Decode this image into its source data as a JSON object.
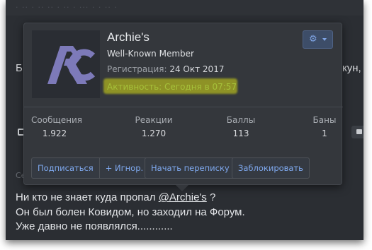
{
  "background": {
    "top_strip_text": "· ·· · ·· ·· · ·· · ··· · · ·· ·",
    "line_left_char": "Б",
    "line_right_text": "кун,",
    "label_se": "Се",
    "post": {
      "line1_before": "Ни кто не знает куда пропал ",
      "mention": "@Archie's",
      "line1_after": " ?",
      "line2": "Он был болен Ковидом, но заходил на Форум.",
      "line3": "Уже давно не появлялся............"
    }
  },
  "member_card": {
    "username": "Archie's",
    "user_title": "Well-Known Member",
    "registered_label": "Регистрация:",
    "registered_date": "24 Окт 2017",
    "activity": "Активность: Сегодня в 07:57",
    "avatar_logo_icon": "archies-logo-icon",
    "settings_icon": "gear-icon",
    "stats": [
      {
        "label": "Сообщения",
        "value": "1.922"
      },
      {
        "label": "Реакции",
        "value": "1.270"
      },
      {
        "label": "Баллы",
        "value": "113"
      },
      {
        "label": "Баны",
        "value": "1"
      }
    ],
    "actions": {
      "follow": "Подписаться",
      "ignore": "+ Игнор.",
      "start_conversation": "Начать переписку",
      "block": "Заблокировать"
    }
  },
  "colors": {
    "link": "#7fa9ef",
    "card_bg": "#34373c",
    "highlight": "#d8de14",
    "activity_text": "#a6c13a"
  }
}
